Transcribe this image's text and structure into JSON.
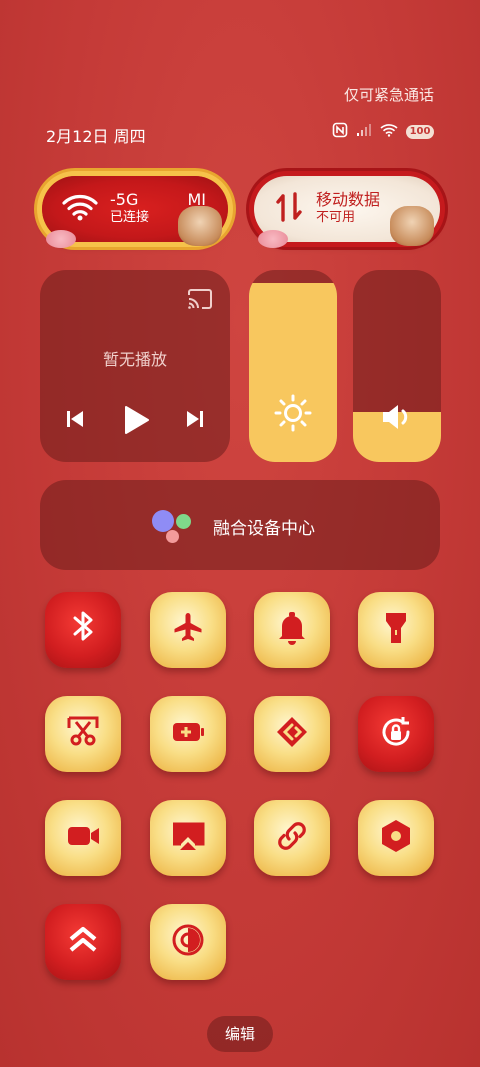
{
  "status": {
    "emergency_text": "仅可紧急通话",
    "date": "2月12日 周四",
    "battery": "100"
  },
  "connectivity": {
    "wifi": {
      "title": "-5G",
      "subtitle": "已连接",
      "suffix": "MI"
    },
    "mobile": {
      "title": "移动数据",
      "subtitle": "不可用"
    }
  },
  "media": {
    "now_playing": "暂无播放"
  },
  "sliders": {
    "brightness_level": 0.93,
    "volume_level": 0.26
  },
  "device_center": {
    "label": "融合设备中心"
  },
  "tiles": [
    {
      "name": "bluetooth",
      "state": "on"
    },
    {
      "name": "airplane",
      "state": "off"
    },
    {
      "name": "bell",
      "state": "off"
    },
    {
      "name": "flashlight",
      "state": "off"
    },
    {
      "name": "screenshot",
      "state": "off"
    },
    {
      "name": "battery-saver",
      "state": "off"
    },
    {
      "name": "share",
      "state": "off"
    },
    {
      "name": "rotation-lock",
      "state": "on"
    },
    {
      "name": "screen-record",
      "state": "off"
    },
    {
      "name": "cast",
      "state": "off"
    },
    {
      "name": "link",
      "state": "off"
    },
    {
      "name": "settings",
      "state": "off"
    },
    {
      "name": "data-saver",
      "state": "on"
    },
    {
      "name": "dark-mode",
      "state": "off"
    }
  ],
  "colors": {
    "accent_red": "#d21e20",
    "gold": "#f8c75e"
  },
  "edit_label": "编辑"
}
